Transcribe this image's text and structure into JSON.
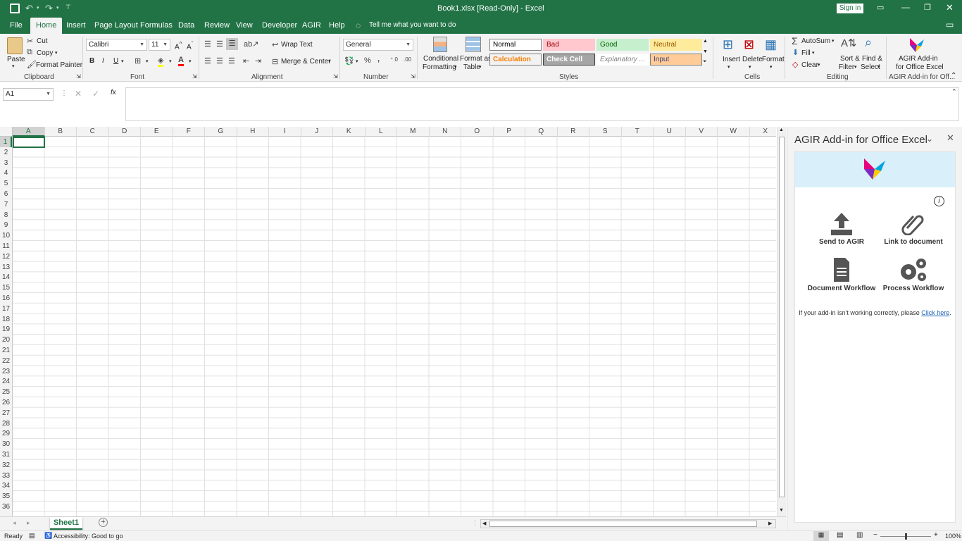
{
  "title": {
    "text": "Book1.xlsx  [Read-Only]  -  Excel",
    "sign_in": "Sign in"
  },
  "quick_access": {
    "icons": [
      "save-icon",
      "undo-icon",
      "redo-icon",
      "customize-icon"
    ]
  },
  "tabs": [
    "File",
    "Home",
    "Insert",
    "Page Layout",
    "Formulas",
    "Data",
    "Review",
    "View",
    "Developer",
    "AGIR",
    "Help"
  ],
  "tell_me": "Tell me what you want to do",
  "ribbon": {
    "clipboard": {
      "paste": "Paste",
      "cut": "Cut",
      "copy": "Copy",
      "format_painter": "Format Painter",
      "label": "Clipboard"
    },
    "font": {
      "name": "Calibri",
      "size": "11",
      "bold": "B",
      "italic": "I",
      "underline": "U",
      "label": "Font"
    },
    "alignment": {
      "wrap": "Wrap Text",
      "merge": "Merge & Center",
      "label": "Alignment"
    },
    "number": {
      "format": "General",
      "label": "Number"
    },
    "styles": {
      "conditional": "Conditional",
      "formatting": "Formatting",
      "format_as": "Format as",
      "table": "Table",
      "cells": [
        {
          "label": "Normal",
          "bg": "#ffffff",
          "color": "#000000",
          "border": "#7f7f7f"
        },
        {
          "label": "Bad",
          "bg": "#ffc7ce",
          "color": "#9c0006",
          "border": "#ffc7ce"
        },
        {
          "label": "Good",
          "bg": "#c6efce",
          "color": "#006100",
          "border": "#c6efce"
        },
        {
          "label": "Neutral",
          "bg": "#ffeb9c",
          "color": "#9c5700",
          "border": "#ffeb9c"
        },
        {
          "label": "Calculation",
          "bg": "#f2f2f2",
          "color": "#fa7d00",
          "border": "#7f7f7f"
        },
        {
          "label": "Check Cell",
          "bg": "#a5a5a5",
          "color": "#ffffff",
          "border": "#3f3f3f"
        },
        {
          "label": "Explanatory ...",
          "bg": "#ffffff",
          "color": "#7f7f7f",
          "border": "#ffffff"
        },
        {
          "label": "Input",
          "bg": "#ffcc99",
          "color": "#3f3f76",
          "border": "#7f7f7f"
        }
      ],
      "label": "Styles"
    },
    "cells": {
      "insert": "Insert",
      "delete": "Delete",
      "format": "Format",
      "label": "Cells"
    },
    "editing": {
      "autosum": "AutoSum",
      "fill": "Fill",
      "clear": "Clear",
      "sort1": "Sort &",
      "sort2": "Filter",
      "find1": "Find &",
      "find2": "Select",
      "label": "Editing"
    },
    "agir": {
      "line1": "AGIR Add-in",
      "line2": "for Office Excel",
      "label": "AGIR Add-in for Off..."
    }
  },
  "formula_bar": {
    "name_box": "A1",
    "fx": "fx",
    "formula": ""
  },
  "columns": [
    "A",
    "B",
    "C",
    "D",
    "E",
    "F",
    "G",
    "H",
    "I",
    "J",
    "K",
    "L",
    "M",
    "N",
    "O",
    "P",
    "Q",
    "R",
    "S",
    "T",
    "U",
    "V",
    "W",
    "X"
  ],
  "rows": [
    "1",
    "2",
    "3",
    "4",
    "5",
    "6",
    "7",
    "8",
    "9",
    "10",
    "11",
    "12",
    "13",
    "14",
    "15",
    "16",
    "17",
    "18",
    "19",
    "20",
    "21",
    "22",
    "23",
    "24",
    "25",
    "26",
    "27",
    "28",
    "29",
    "30",
    "31",
    "32",
    "33",
    "34",
    "35",
    "36"
  ],
  "sheets": [
    "Sheet1"
  ],
  "task_pane": {
    "title": "AGIR Add-in for Office Excel",
    "buttons": [
      {
        "label": "Send to AGIR",
        "icon": "upload-icon"
      },
      {
        "label": "Link to document",
        "icon": "paperclip-icon"
      },
      {
        "label": "Document Workflow",
        "icon": "document-icon"
      },
      {
        "label": "Process Workflow",
        "icon": "gears-icon"
      }
    ],
    "help_text": "If your add-in isn't working correctly, please",
    "help_link": "Click here",
    "help_end": "."
  },
  "status": {
    "ready": "Ready",
    "accessibility": "Accessibility: Good to go",
    "zoom": "100%"
  },
  "colors": {
    "excel_green": "#217346",
    "ribbon_bg": "#f3f3f3"
  }
}
